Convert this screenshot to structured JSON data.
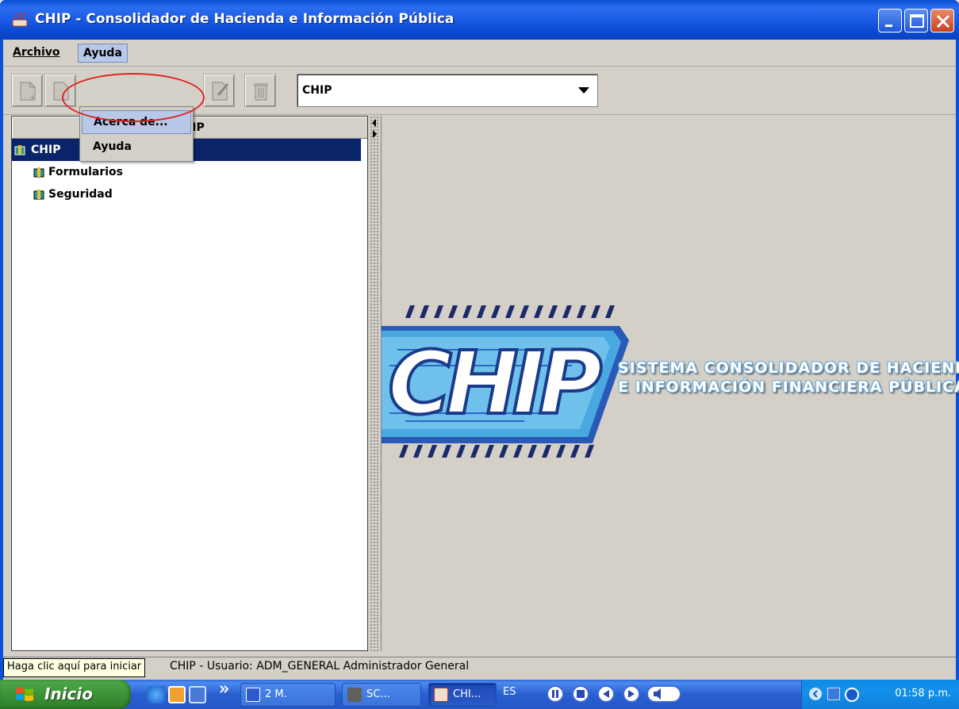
{
  "window": {
    "title": "CHIP - Consolidador de Hacienda e Información Pública"
  },
  "menubar": {
    "items": [
      {
        "label": "Archivo"
      },
      {
        "label": "Ayuda"
      }
    ]
  },
  "dropdown": {
    "items": [
      {
        "label": "Acerca de..."
      },
      {
        "label": "Ayuda"
      }
    ]
  },
  "toolbar": {
    "combo_value": "CHIP"
  },
  "left_pane": {
    "header": "CHIP",
    "tree": [
      {
        "label": "CHIP",
        "selected": true
      },
      {
        "label": "Formularios"
      },
      {
        "label": "Seguridad"
      }
    ]
  },
  "logo": {
    "line1": "SISTEMA CONSOLIDADOR DE HACIENDA",
    "line2": "E INFORMACIÓN FINANCIERA PÚBLICA"
  },
  "statusbar": {
    "text": "CHIP - Usuario: ADM_GENERAL  Administrador General"
  },
  "tooltip": {
    "text": "Haga clic aquí para iniciar"
  },
  "taskbar": {
    "start_label": "Inicio",
    "tasks": [
      {
        "label": "2 M."
      },
      {
        "label": "SC..."
      },
      {
        "label": "CHI..."
      }
    ],
    "language": "ES",
    "clock": "01:58 p.m."
  },
  "colors": {
    "selection": "#0a246a",
    "titlebar": "#0a4fd3",
    "window_bg": "#d4d0c8",
    "annotation": "#e02020"
  }
}
